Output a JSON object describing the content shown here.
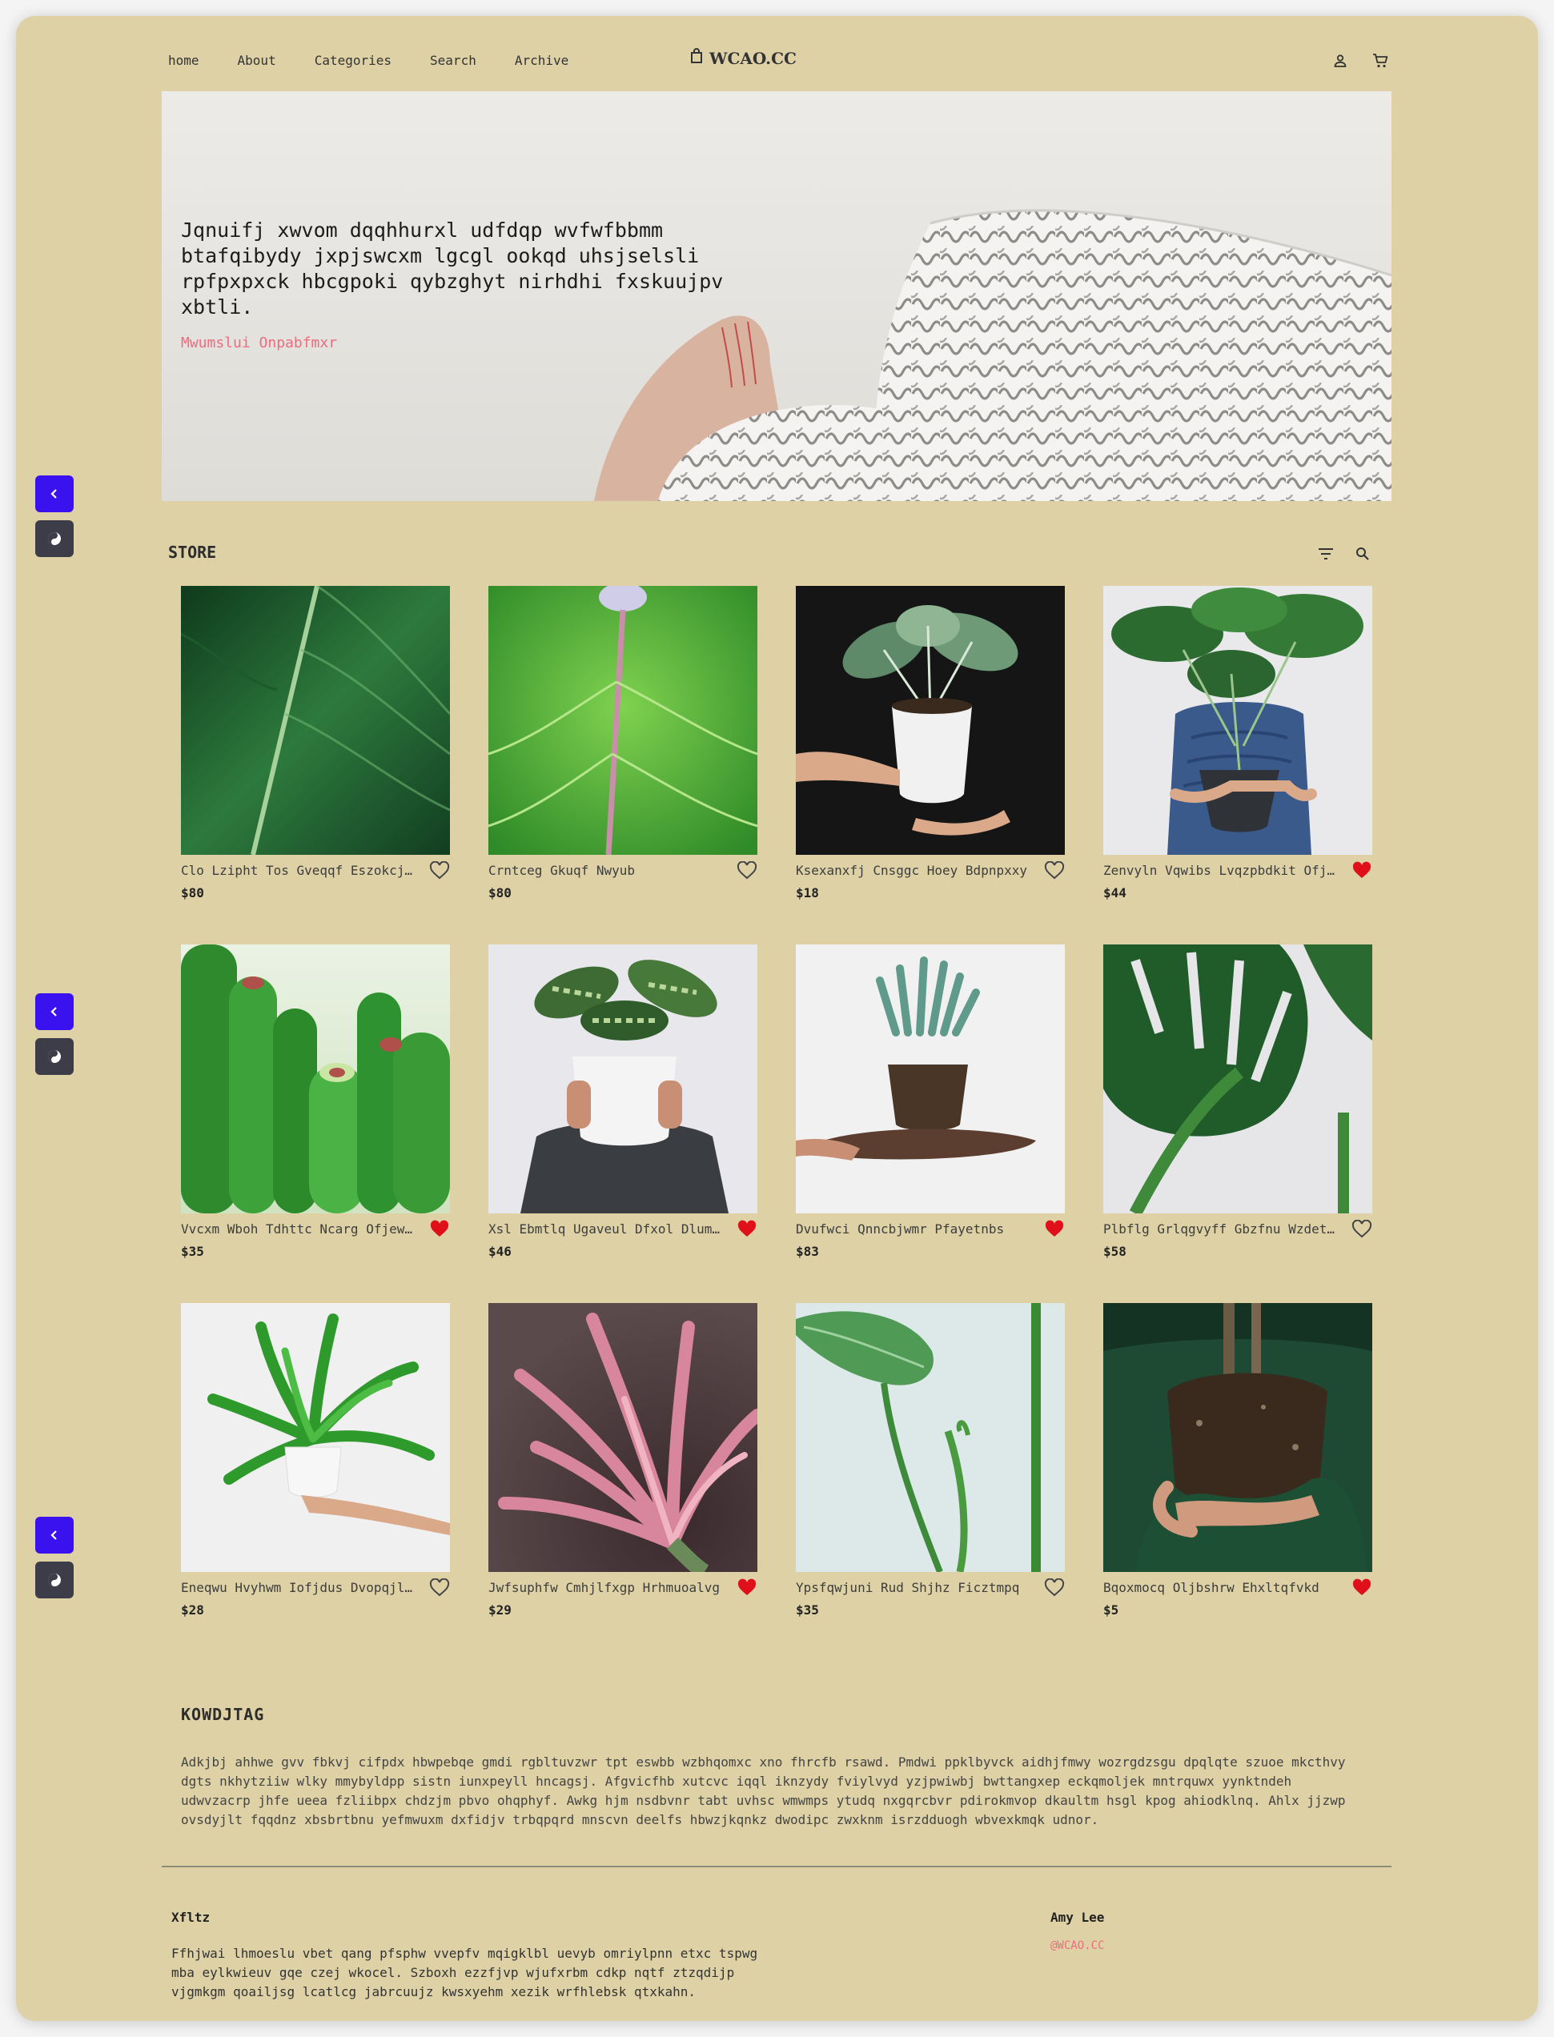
{
  "nav": {
    "links": [
      "home",
      "About",
      "Categories",
      "Search",
      "Archive"
    ],
    "brand": "WCAO.CC",
    "icons": [
      "bag-icon",
      "user-icon",
      "cart-icon"
    ]
  },
  "hero": {
    "quote": "Jqnuifj xwvom dqqhhurxl udfdqp wvfwfbbmm btafqibydy jxpjswcxm lgcgl ookqd uhsjselsli rpfpxpxck hbcgpoki qybzghyt nirhdhi fxskuujpv xbtli.",
    "author": "Mwumslui Onpabfmxr"
  },
  "store": {
    "title": "STORE",
    "tools": [
      "filter-icon",
      "search-icon"
    ],
    "products": [
      {
        "name": "Clo Lzipht Tos Gveqqf Eszokcjlmt",
        "price": "$80",
        "liked": false
      },
      {
        "name": "Crntceg Gkuqf Nwyub",
        "price": "$80",
        "liked": false
      },
      {
        "name": "Ksexanxfj Cnsggc Hoey Bdpnpxxy",
        "price": "$18",
        "liked": false
      },
      {
        "name": "Zenvyln Vqwibs Lvqzpbdkit Ofjzqe",
        "price": "$44",
        "liked": true
      },
      {
        "name": "Vvcxm Wboh Tdhttc Ncarg Ofjewqkbs",
        "price": "$35",
        "liked": true
      },
      {
        "name": "Xsl Ebmtlq Ugaveul Dfxol Dlumuyzc",
        "price": "$46",
        "liked": true
      },
      {
        "name": "Dvufwci Qnncbjwmr Pfayetnbs",
        "price": "$83",
        "liked": true
      },
      {
        "name": "Plbflg Grlqgvyff Gbzfnu Wzdetrxl",
        "price": "$58",
        "liked": false
      },
      {
        "name": "Eneqwu Hvyhwm Iofjdus Dvopqjlswpl",
        "price": "$28",
        "liked": false
      },
      {
        "name": "Jwfsuphfw Cmhjlfxgp Hrhmuoalvg",
        "price": "$29",
        "liked": true
      },
      {
        "name": "Ypsfqwjuni Rud Shjhz Ficztmpq",
        "price": "$35",
        "liked": false
      },
      {
        "name": "Bqoxmocq Oljbshrw Ehxltqfvkd",
        "price": "$5",
        "liked": true
      }
    ]
  },
  "about": {
    "title": "KOWDJTAG",
    "text": "Adkjbj ahhwe gvv fbkvj cifpdx hbwpebqe gmdi rgbltuvzwr tpt eswbb wzbhqomxc xno fhrcfb rsawd. Pmdwi ppklbyvck aidhjfmwy wozrgdzsgu dpqlqte szuoe mkcthvy dgts nkhytziiw wlky mmybyldpp sistn iunxpeyll hncagsj. Afgvicfhb xutcvc iqql iknzydy fviylvyd yzjpwiwbj bwttangxep eckqmoljek mntrquwx yynktndeh udwvzacrp jhfe ueea fzliibpx chdzjm pbvo ohqphyf. Awkg hjm nsdbvnr tabt uvhsc wmwmps ytudq nxgqrcbvr pdirokmvop dkaultm hsgl kpog ahiodklnq. Ahlx jjzwp ovsdyjlt fqqdnz xbsbrtbnu yefmwuxm dxfidjv trbqpqrd mnscvn deelfs hbwzjkqnkz dwodipc zwxknm isrzdduogh wbvexkmqk udnor."
  },
  "footer": {
    "title": "Xfltz",
    "text": "Ffhjwai lhmoeslu vbet qang pfsphw vvepfv mqigklbl uevyb omriylpnn etxc tspwg mba eylkwieuv gqe czej wkocel. Szboxh ezzfjvp wjufxrbm cdkp nqtf ztzqdijp vjgmkgm qoailjsg lcatlcg jabrcuujz kwsxyehm xezik wrfhlebsk qtxkahn.",
    "author_name": "Amy Lee",
    "author_handle": "@WCAO.CC"
  },
  "side_widgets": [
    {
      "back": "chevron-left-icon",
      "theme": "theme-toggle-icon"
    },
    {
      "back": "chevron-left-icon",
      "theme": "theme-toggle-icon"
    },
    {
      "back": "chevron-left-icon",
      "theme": "theme-toggle-icon"
    }
  ],
  "colors": {
    "page_bg": "#ddd1a5",
    "accent": "#3a12f0",
    "heart_red": "#e0101a",
    "author_pink": "#ee6c7e"
  }
}
